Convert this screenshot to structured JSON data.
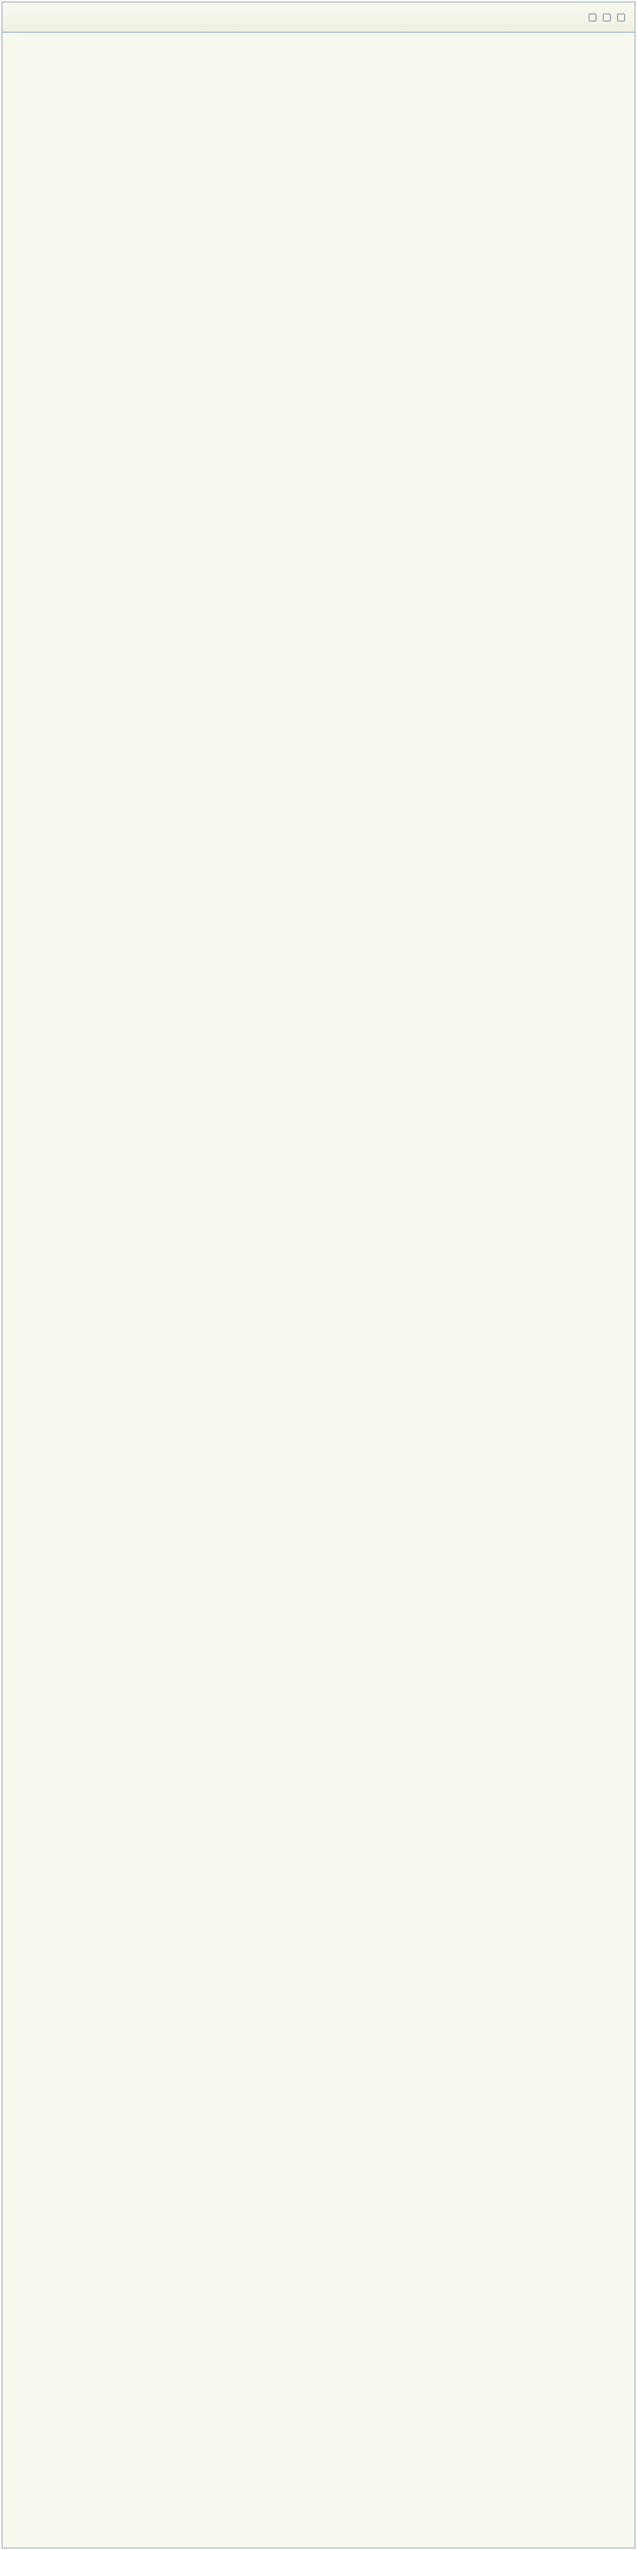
{
  "thread": {
    "title": "",
    "copy_label": ""
  },
  "posts": []
}
